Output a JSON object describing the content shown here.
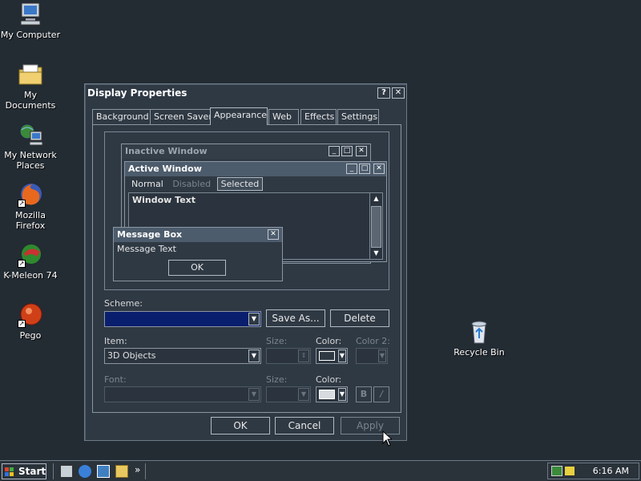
{
  "desktop": {
    "icons": [
      {
        "label": "My Computer",
        "icon": "computer-icon"
      },
      {
        "label": "My Documents",
        "icon": "folder-documents-icon"
      },
      {
        "label": "My Network Places",
        "icon": "network-places-icon"
      },
      {
        "label": "Mozilla Firefox",
        "icon": "firefox-icon"
      },
      {
        "label": "K-Meleon 74",
        "icon": "kmeleon-icon"
      },
      {
        "label": "Pego",
        "icon": "pego-icon"
      },
      {
        "label": "Recycle Bin",
        "icon": "recycle-bin-icon"
      }
    ]
  },
  "dialog": {
    "title": "Display Properties",
    "help_btn": "?",
    "close_btn": "✕",
    "tabs": [
      "Background",
      "Screen Saver",
      "Appearance",
      "Web",
      "Effects",
      "Settings"
    ],
    "active_tab": "Appearance",
    "preview": {
      "inactive_title": "Inactive Window",
      "active_title": "Active Window",
      "menu_normal": "Normal",
      "menu_disabled": "Disabled",
      "menu_selected": "Selected",
      "window_text": "Window Text",
      "msgbox_title": "Message Box",
      "msgbox_text": "Message Text",
      "msgbox_ok": "OK"
    },
    "scheme_label": "Scheme:",
    "scheme_value": "",
    "save_as": "Save As...",
    "delete": "Delete",
    "item_label": "Item:",
    "item_value": "3D Objects",
    "size_label": "Size:",
    "color_label": "Color:",
    "color2_label": "Color 2:",
    "font_label": "Font:",
    "font_size_label": "Size:",
    "font_color_label": "Color:",
    "bold_btn": "B",
    "italic_btn": "/",
    "ok": "OK",
    "cancel": "Cancel",
    "apply": "Apply",
    "colors": {
      "scheme_fill": "#0a1e6e",
      "item_color": "#2f3944",
      "font_color": "#d8dce0"
    }
  },
  "taskbar": {
    "start": "Start",
    "chevron": "»",
    "clock": "6:16 AM"
  }
}
